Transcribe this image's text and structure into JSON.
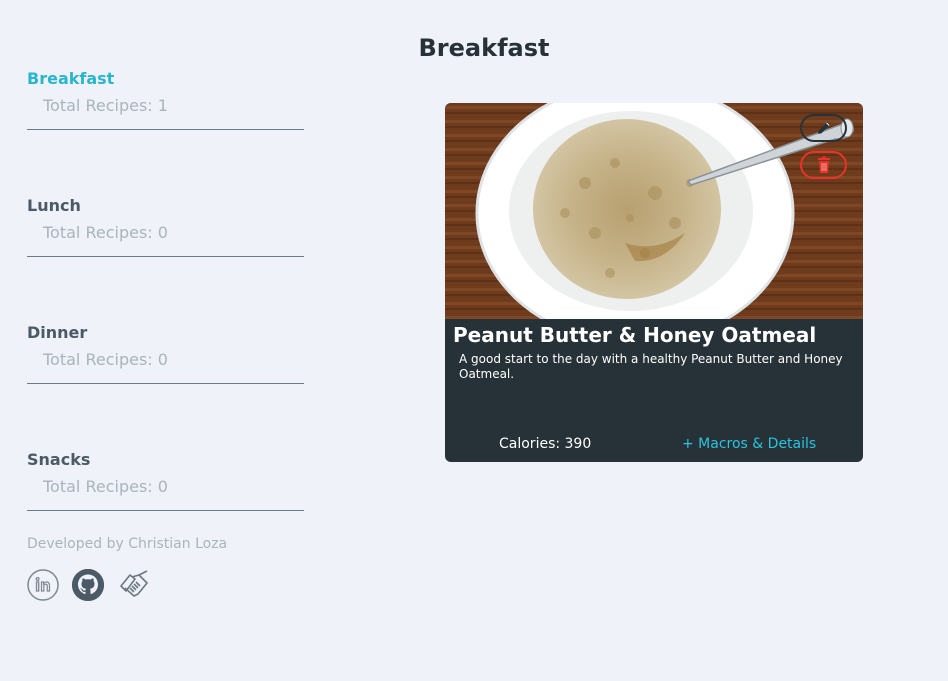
{
  "page": {
    "title": "Breakfast"
  },
  "sidebar": {
    "categories": [
      {
        "name": "Breakfast",
        "count": "Total Recipes: 1",
        "active": true
      },
      {
        "name": "Lunch",
        "count": "Total Recipes: 0",
        "active": false
      },
      {
        "name": "Dinner",
        "count": "Total Recipes: 0",
        "active": false
      },
      {
        "name": "Snacks",
        "count": "Total Recipes: 0",
        "active": false
      }
    ],
    "footer": "Developed by Christian Loza",
    "social_icons": [
      "linkedin-icon",
      "github-icon",
      "handshake-icon"
    ]
  },
  "recipe_card": {
    "title": "Peanut Butter & Honey Oatmeal",
    "description": "A good start to the day with a healthy Peanut Butter and Honey Oatmeal.",
    "calories": "Calories: 390",
    "details_link": "+ Macros & Details",
    "edit_icon": "pencil-icon",
    "delete_icon": "trash-icon"
  },
  "colors": {
    "background": "#eff2f8",
    "accent": "#29b6cc",
    "card_background": "#263238",
    "delete": "#e8322a",
    "link": "#29c4de"
  }
}
